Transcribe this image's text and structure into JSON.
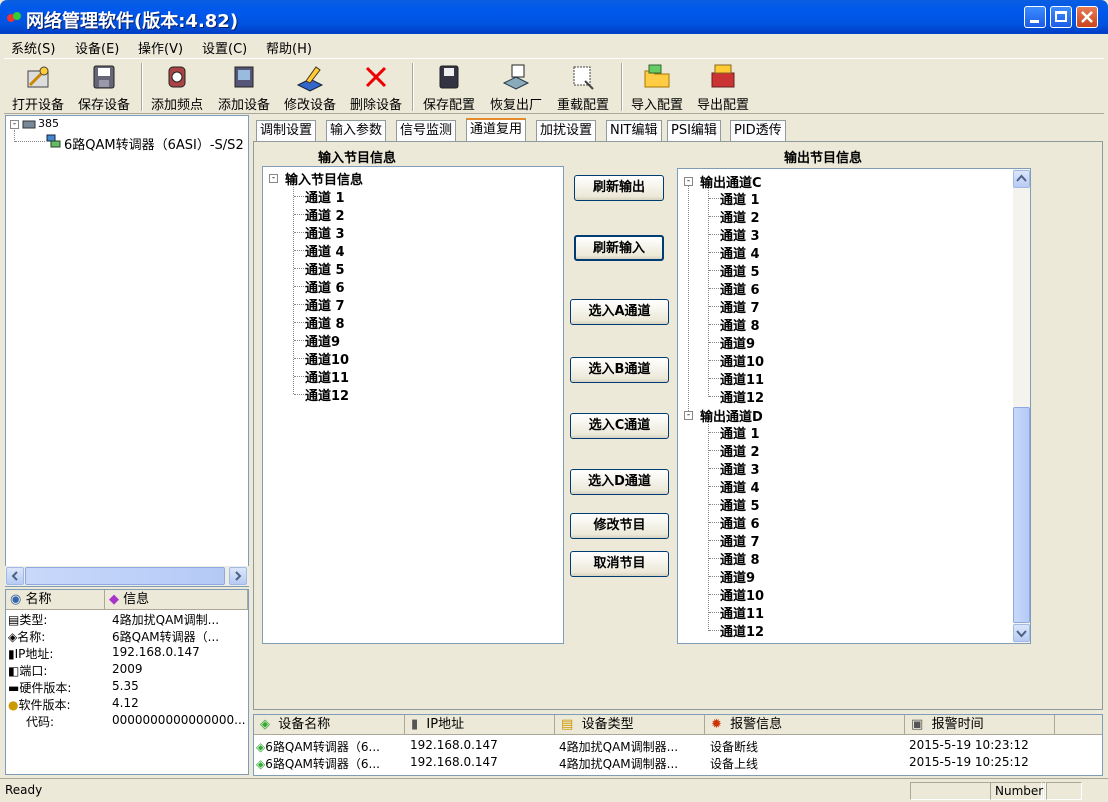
{
  "window": {
    "title": "网络管理软件(版本:4.82)"
  },
  "menu": [
    "系统(S)",
    "设备(E)",
    "操作(V)",
    "设置(C)",
    "帮助(H)"
  ],
  "toolbar": [
    "打开设备",
    "保存设备",
    "添加频点",
    "添加设备",
    "修改设备",
    "删除设备",
    "保存配置",
    "恢复出厂",
    "重载配置",
    "导入配置",
    "导出配置"
  ],
  "device_tree": {
    "root": "385",
    "child": "6路QAM转调器（6ASI）-S/S2"
  },
  "info_table": {
    "headers": [
      "名称",
      "信息"
    ],
    "rows": [
      {
        "key": "类型:",
        "value": "4路加扰QAM调制..."
      },
      {
        "key": "名称:",
        "value": "6路QAM转调器（..."
      },
      {
        "key": "IP地址:",
        "value": "192.168.0.147"
      },
      {
        "key": "端口:",
        "value": "2009"
      },
      {
        "key": "硬件版本:",
        "value": "5.35"
      },
      {
        "key": "软件版本:",
        "value": "4.12"
      },
      {
        "key": "代码:",
        "value": "0000000000000000..."
      }
    ]
  },
  "tabs": [
    "调制设置",
    "输入参数",
    "信号监测",
    "通道复用",
    "加扰设置",
    "NIT编辑",
    "PSI编辑",
    "PID透传"
  ],
  "active_tab": "通道复用",
  "input_panel": {
    "title": "输入节目信息",
    "root": "输入节目信息",
    "channels": [
      "通道 1",
      "通道 2",
      "通道 3",
      "通道 4",
      "通道 5",
      "通道 6",
      "通道 7",
      "通道 8",
      "通道9",
      "通道10",
      "通道11",
      "通道12"
    ]
  },
  "buttons": [
    "刷新输出",
    "刷新输入",
    "选入A通道",
    "选入B通道",
    "选入C通道",
    "选入D通道",
    "修改节目",
    "取消节目"
  ],
  "output_panel": {
    "title": "输出节目信息",
    "groups": [
      {
        "name": "输出通道C",
        "channels": [
          "通道 1",
          "通道 2",
          "通道 3",
          "通道 4",
          "通道 5",
          "通道 6",
          "通道 7",
          "通道 8",
          "通道9",
          "通道10",
          "通道11",
          "通道12"
        ]
      },
      {
        "name": "输出通道D",
        "channels": [
          "通道 1",
          "通道 2",
          "通道 3",
          "通道 4",
          "通道 5",
          "通道 6",
          "通道 7",
          "通道 8",
          "通道9",
          "通道10",
          "通道11",
          "通道12"
        ]
      }
    ]
  },
  "alarm_table": {
    "headers": [
      "设备名称",
      "IP地址",
      "设备类型",
      "报警信息",
      "报警时间"
    ],
    "rows": [
      [
        "6路QAM转调器（6...",
        "192.168.0.147",
        "4路加扰QAM调制器...",
        "设备断线",
        "2015-5-19 10:23:12"
      ],
      [
        "6路QAM转调器（6...",
        "192.168.0.147",
        "4路加扰QAM调制器...",
        "设备上线",
        "2015-5-19 10:25:12"
      ]
    ]
  },
  "status": {
    "text": "Ready",
    "indicator": "Number"
  }
}
